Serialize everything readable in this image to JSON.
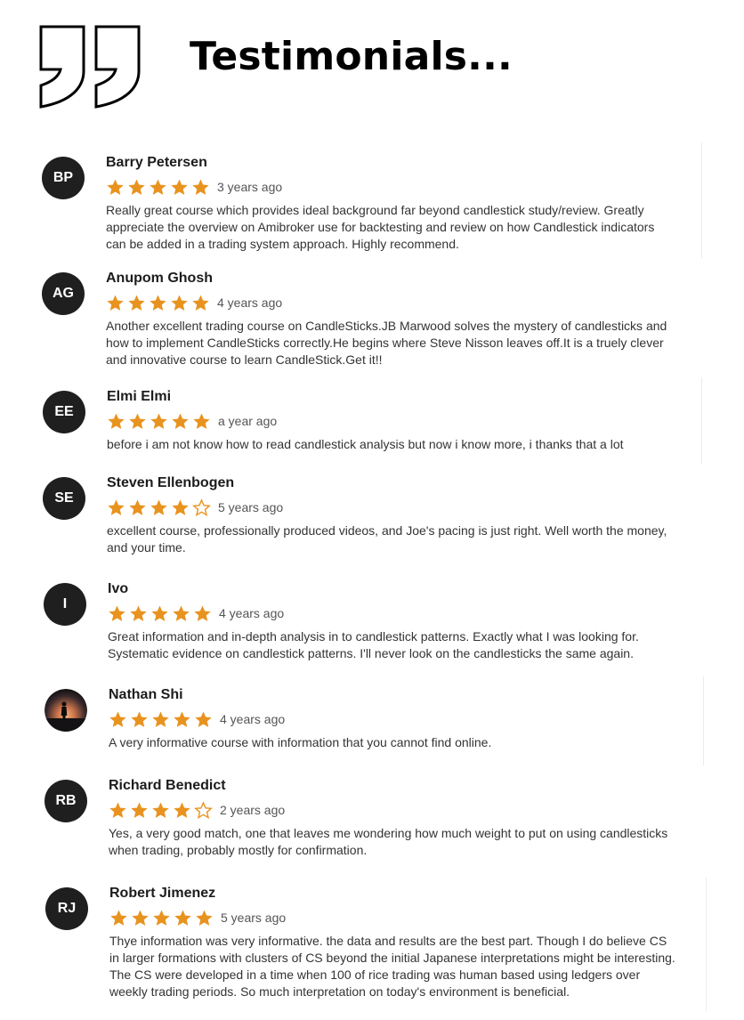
{
  "header": {
    "title": "Testimonials...",
    "icon": "quotation-marks-icon"
  },
  "colors": {
    "star": "#e8931f",
    "avatar_bg": "#1f1f1f"
  },
  "reviews": [
    {
      "initials": "BP",
      "name": "Barry Petersen",
      "rating": 5,
      "time": "3 years ago",
      "text": "Really great course which provides ideal background far beyond candlestick study/review. Greatly appreciate the overview on Amibroker use for backtesting and review on how Candlestick indicators can be added in a trading system approach. Highly recommend."
    },
    {
      "initials": "AG",
      "name": "Anupom Ghosh",
      "rating": 5,
      "time": "4 years ago",
      "text": "Another excellent trading course on CandleSticks.JB Marwood solves the mystery of candlesticks and how to implement CandleSticks correctly.He begins where Steve Nisson leaves off.It is a truely clever and innovative course to learn CandleStick.Get it!!"
    },
    {
      "initials": "EE",
      "name": "Elmi Elmi",
      "rating": 5,
      "time": "a year ago",
      "text": "before i am not know how to read candlestick analysis but now i know more, i thanks that a lot"
    },
    {
      "initials": "SE",
      "name": "Steven Ellenbogen",
      "rating": 4,
      "time": "5 years ago",
      "text": "excellent course, professionally produced videos, and Joe's pacing is just right. Well worth the money, and your time."
    },
    {
      "initials": "I",
      "name": "Ivo",
      "rating": 5,
      "time": "4 years ago",
      "text": "Great information and in-depth analysis in to candlestick patterns. Exactly what I was looking for. Systematic evidence on candlestick patterns. I'll never look on the candlesticks the same again."
    },
    {
      "initials": "",
      "avatar": "photo-silhouette-sunset",
      "name": "Nathan Shi",
      "rating": 5,
      "time": "4 years ago",
      "text": "A very informative course with information that you cannot find online."
    },
    {
      "initials": "RB",
      "name": "Richard Benedict",
      "rating": 4,
      "time": "2 years ago",
      "text": "Yes, a very good match, one that leaves me wondering how much weight to put on using candlesticks when trading, probably mostly for confirmation."
    },
    {
      "initials": "RJ",
      "name": "Robert Jimenez",
      "rating": 5,
      "time": "5 years ago",
      "text": "Thye information was very informative. the data and results are the best part. Though I do believe CS in larger formations with clusters of CS beyond the initial Japanese interpretations might be interesting. The CS were developed in a time when 100 of rice trading was human based using ledgers over weekly trading periods. So much interpretation on today's environment is beneficial."
    }
  ]
}
